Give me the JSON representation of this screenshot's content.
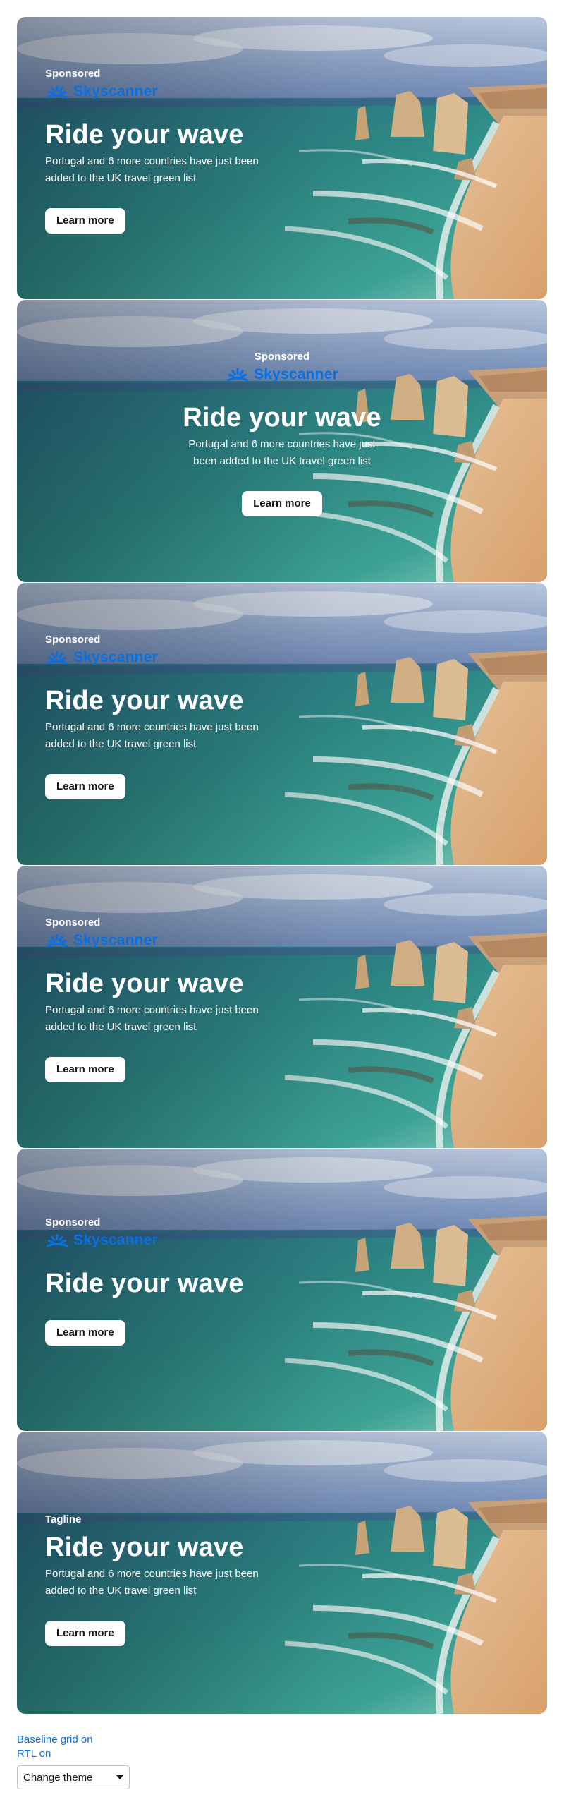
{
  "brand": {
    "name": "Skyscanner",
    "color": "#0770e3"
  },
  "cards": [
    {
      "variant": "left",
      "tag": "Sponsored",
      "logo": true,
      "headline": "Ride your wave",
      "description": "Portugal and 6 more countries have just been added to the UK travel green list",
      "button": "Learn more"
    },
    {
      "variant": "center",
      "tag": "Sponsored",
      "logo": true,
      "headline": "Ride your wave",
      "description": "Portugal and 6 more countries have just been added to the UK travel green list",
      "button": "Learn more"
    },
    {
      "variant": "left",
      "tag": "Sponsored",
      "logo": true,
      "headline": "Ride your wave",
      "description": "Portugal and 6 more countries have just been added to the UK travel green list",
      "button": "Learn more"
    },
    {
      "variant": "left",
      "tag": "Sponsored",
      "logo": true,
      "headline": "Ride your wave",
      "description": "Portugal and 6 more countries have just been added to the UK travel green list",
      "button": "Learn more"
    },
    {
      "variant": "left",
      "tag": "Sponsored",
      "logo": true,
      "headline": "Ride your wave",
      "description": "",
      "button": "Learn more"
    },
    {
      "variant": "left",
      "tag": "Tagline",
      "logo": false,
      "headline": "Ride your wave",
      "description": "Portugal and 6 more countries have just been added to the UK travel green list",
      "button": "Learn more"
    }
  ],
  "footer": {
    "baseline_link": "Baseline grid on",
    "rtl_link": "RTL on",
    "theme_select": "Change theme"
  }
}
